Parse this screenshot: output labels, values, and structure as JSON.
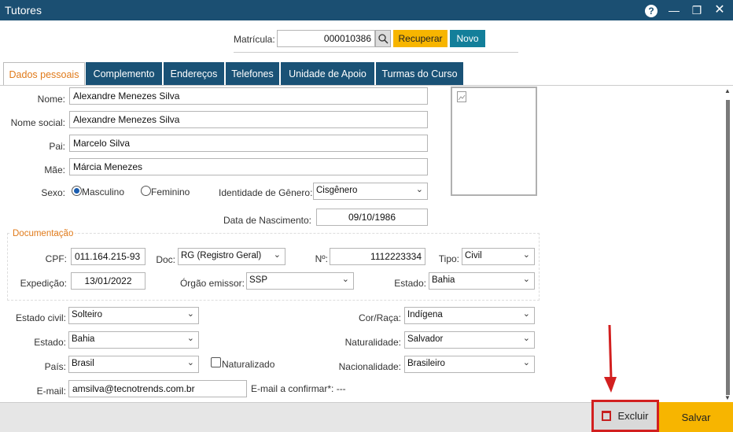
{
  "window": {
    "title": "Tutores",
    "help_glyph": "?",
    "minimize_glyph": "—",
    "maximize_glyph": "❐",
    "close_glyph": "✕"
  },
  "header": {
    "matricula_label": "Matrícula:",
    "matricula_value": "000010386",
    "recuperar_label": "Recuperar",
    "novo_label": "Novo"
  },
  "tabs": [
    {
      "label": "Dados pessoais",
      "active": true
    },
    {
      "label": "Complemento",
      "active": false
    },
    {
      "label": "Endereços",
      "active": false
    },
    {
      "label": "Telefones",
      "active": false
    },
    {
      "label": "Unidade de Apoio",
      "active": false
    },
    {
      "label": "Turmas do Curso",
      "active": false
    }
  ],
  "personal": {
    "nome_label": "Nome:",
    "nome_value": "Alexandre Menezes Silva",
    "nome_social_label": "Nome social:",
    "nome_social_value": "Alexandre Menezes Silva",
    "pai_label": "Pai:",
    "pai_value": "Marcelo Silva",
    "mae_label": "Mãe:",
    "mae_value": "Márcia Menezes",
    "sexo_label": "Sexo:",
    "sexo_options": [
      "Masculino",
      "Feminino"
    ],
    "sexo_selected": "Masculino",
    "identidade_label": "Identidade de Gênero:",
    "identidade_value": "Cisgênero",
    "nascimento_label": "Data de Nascimento:",
    "nascimento_value": "09/10/1986"
  },
  "documentacao": {
    "title": "Documentação",
    "cpf_label": "CPF:",
    "cpf_value": "011.164.215-93",
    "doc_label": "Doc:",
    "doc_value": "RG (Registro Geral)",
    "numero_label": "Nº:",
    "numero_value": "1112223334",
    "tipo_label": "Tipo:",
    "tipo_value": "Civil",
    "expedicao_label": "Expedição:",
    "expedicao_value": "13/01/2022",
    "orgao_label": "Órgão emissor:",
    "orgao_value": "SSP",
    "estado_label": "Estado:",
    "estado_value": "Bahia"
  },
  "other": {
    "estado_civil_label": "Estado civil:",
    "estado_civil_value": "Solteiro",
    "estado_label": "Estado:",
    "estado_value": "Bahia",
    "pais_label": "País:",
    "pais_value": "Brasil",
    "naturalizado_label": "Naturalizado",
    "email_label": "E-mail:",
    "email_value": "amsilva@tecnotrends.com.br",
    "email_confirm_label": "E-mail a confirmar*: ---",
    "cor_label": "Cor/Raça:",
    "cor_value": "Indígena",
    "naturalidade_label": "Naturalidade:",
    "naturalidade_value": "Salvador",
    "nacionalidade_label": "Nacionalidade:",
    "nacionalidade_value": "Brasileiro"
  },
  "footer": {
    "excluir_label": "Excluir",
    "salvar_label": "Salvar"
  },
  "colors": {
    "titlebar": "#1b4f72",
    "tab": "#1a5276",
    "accent_orange": "#e07a1a",
    "yellow_button": "#f7b500",
    "teal_button": "#137f9a",
    "highlight_red": "#d21f1f"
  }
}
